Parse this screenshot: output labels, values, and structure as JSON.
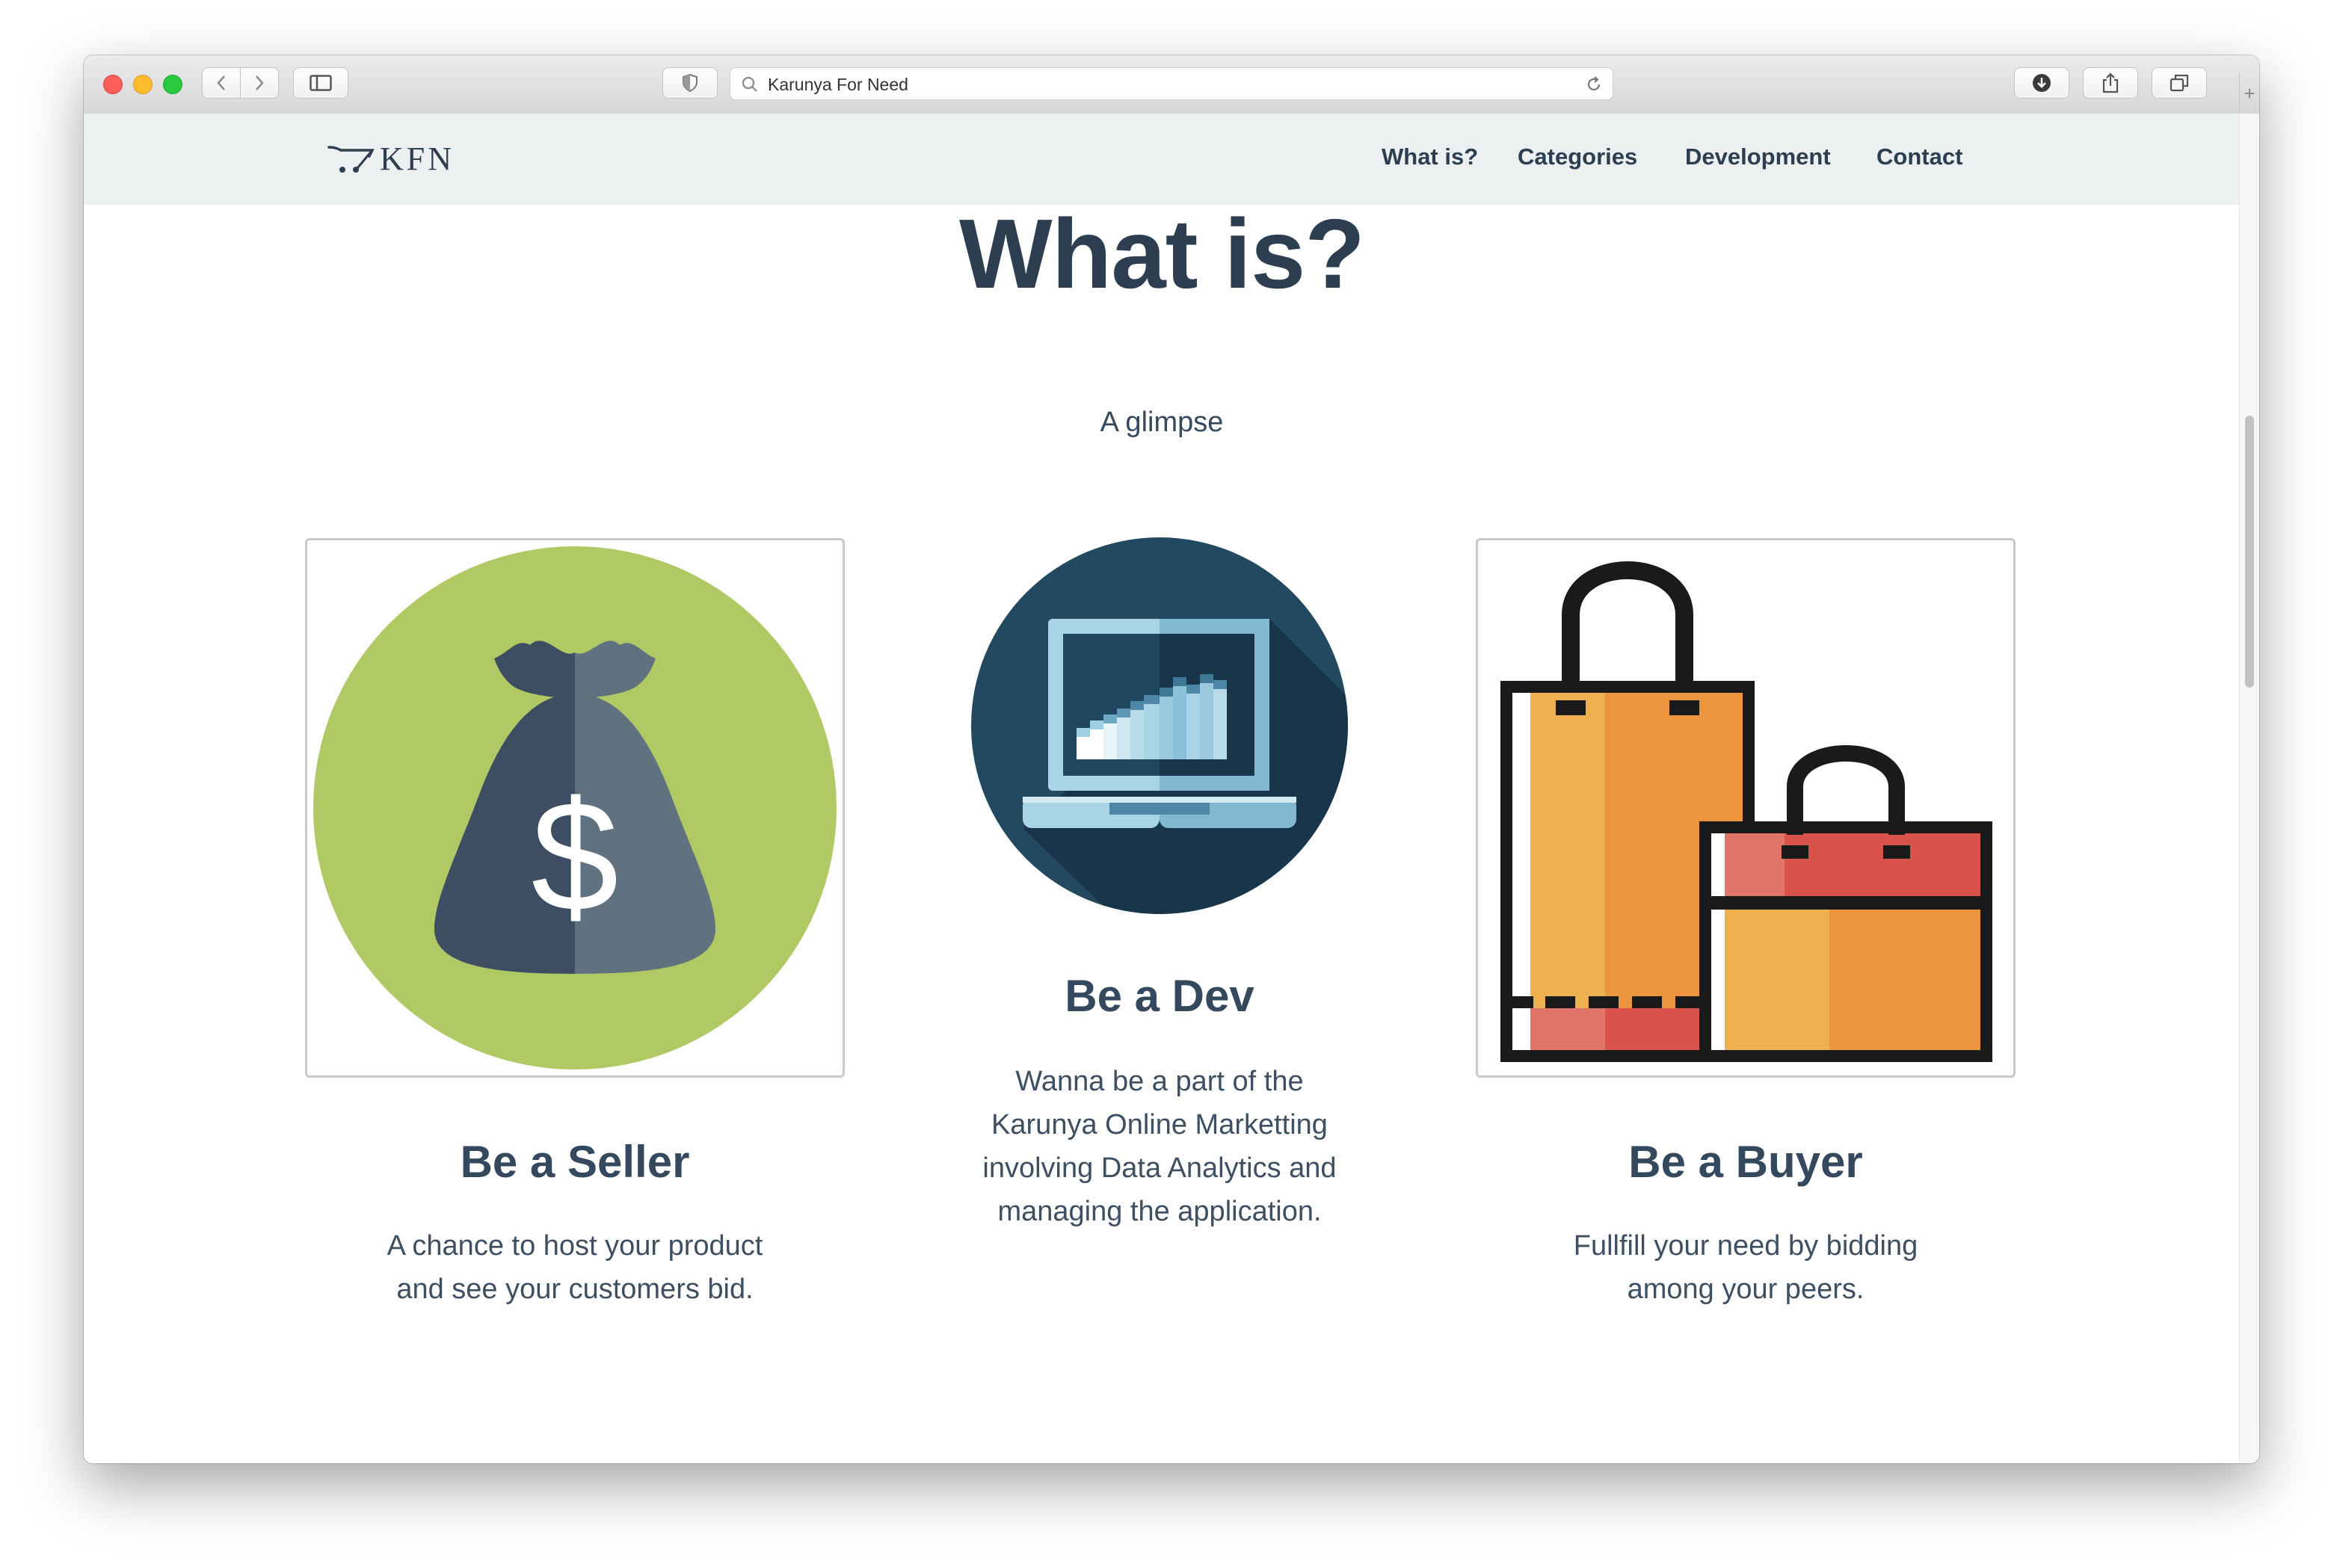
{
  "browser": {
    "url_text": "Karunya For Need",
    "new_tab_symbol": "+"
  },
  "site": {
    "logo_text": "KFN",
    "nav": [
      "What is?",
      "Categories",
      "Development",
      "Contact"
    ]
  },
  "section": {
    "title": "What is?",
    "subtitle": "A glimpse"
  },
  "cards": [
    {
      "title": "Be a Seller",
      "description": "A chance to host your product and see your customers bid.",
      "icon": "money-bag-icon"
    },
    {
      "title": "Be a Dev",
      "description": "Wanna be a part of the Karunya Online Marketting involving Data Analytics and managing the application.",
      "icon": "laptop-chart-icon"
    },
    {
      "title": "Be a Buyer",
      "description": "Fullfill your need by bidding among your peers.",
      "icon": "shopping-bags-icon"
    }
  ],
  "colors": {
    "navbar_bg": "#ecf0f1",
    "heading": "#2c3e50",
    "seller_circle": "#b0c964",
    "dev_circle": "#22495f",
    "bag_orange": "#efb050",
    "bag_red": "#d9534a"
  }
}
